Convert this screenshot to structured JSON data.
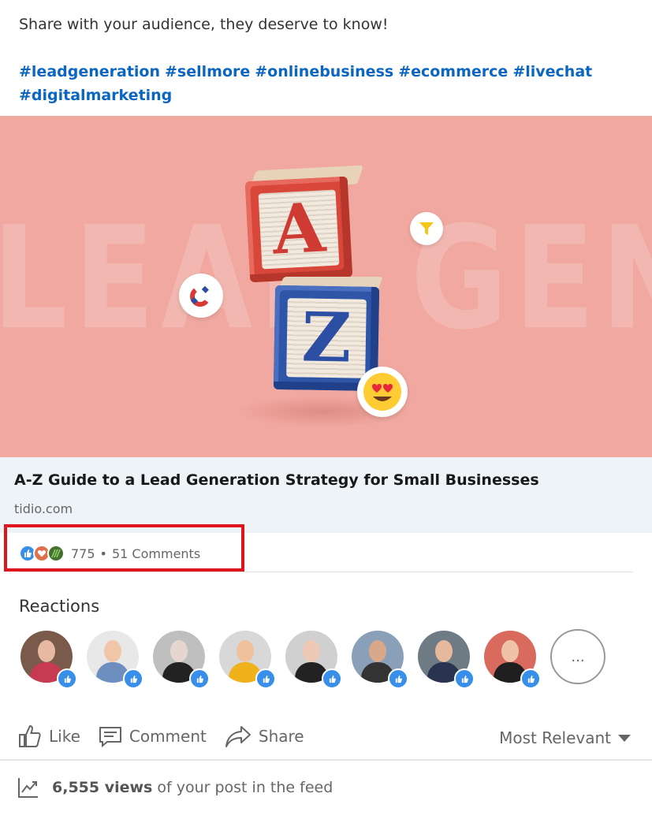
{
  "post": {
    "text": "Share with your audience, they deserve to know!",
    "hashtags": [
      "#leadgeneration",
      "#sellmore",
      "#onlinebusiness",
      "#ecommerce",
      "#livechat"
    ],
    "hashtags_line2": [
      "#digitalmarketing"
    ]
  },
  "hero": {
    "letter_top": "A",
    "letter_bottom": "Z",
    "bg_word": "LEAD GENERATION"
  },
  "link": {
    "title": "A-Z Guide to a Lead Generation Strategy for Small Businesses",
    "domain": "tidio.com"
  },
  "social": {
    "reaction_count": "775",
    "separator": "•",
    "comments": "51 Comments"
  },
  "reactions": {
    "title": "Reactions",
    "more_label": "...",
    "avatars": [
      {
        "skin": "#e7b9a2",
        "body": "#c83a52",
        "bg": "#7a5a4a"
      },
      {
        "skin": "#f0c5a8",
        "body": "#6c8fbf",
        "bg": "#e8e8e8"
      },
      {
        "skin": "#e6d6cf",
        "body": "#222222",
        "bg": "#bfbfbf"
      },
      {
        "skin": "#efc19c",
        "body": "#f0b21a",
        "bg": "#d8d8d8"
      },
      {
        "skin": "#eec9b5",
        "body": "#222222",
        "bg": "#d0d0d0"
      },
      {
        "skin": "#d7a88a",
        "body": "#333333",
        "bg": "#8aa0b8"
      },
      {
        "skin": "#e6b89c",
        "body": "#2a3350",
        "bg": "#6e7b84"
      },
      {
        "skin": "#efc3a7",
        "body": "#1f1f1f",
        "bg": "#d96a5e"
      }
    ]
  },
  "actions": {
    "like": "Like",
    "comment": "Comment",
    "share": "Share",
    "sort": "Most Relevant"
  },
  "views": {
    "count": "6,555 views",
    "suffix": "of your post in the feed"
  },
  "colors": {
    "hero_bg": "#f0a8a0",
    "link_accent": "#0a66c2",
    "highlight": "#e0151b"
  }
}
